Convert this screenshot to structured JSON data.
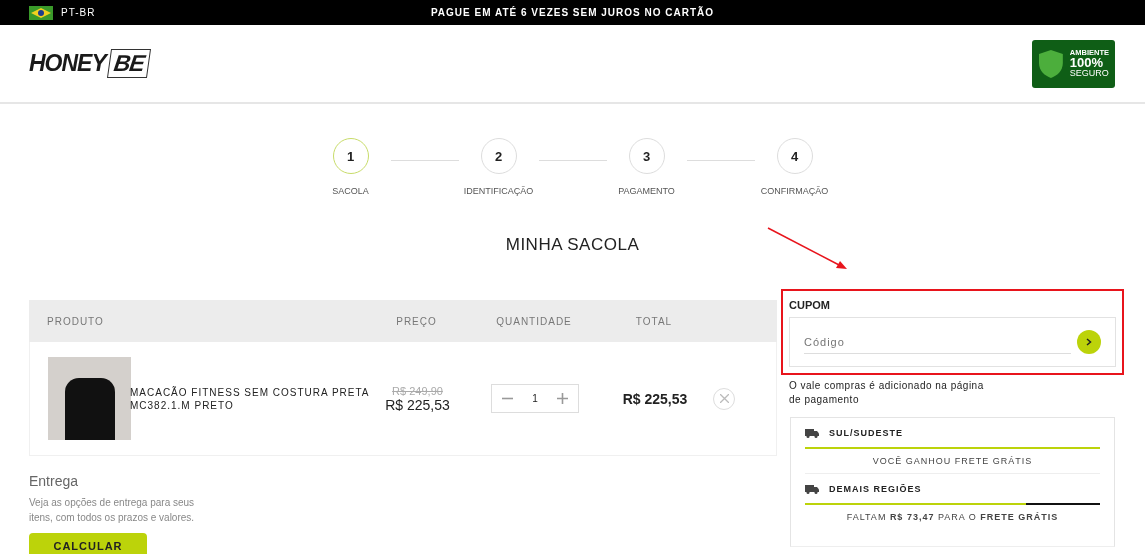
{
  "top_bar": {
    "language": "PT-BR",
    "promo": "PAGUE EM ATÉ 6 VEZES SEM JUROS NO CARTÃO"
  },
  "header": {
    "logo": [
      "HONEY",
      "BE"
    ],
    "security_badge": [
      "AMBIENTE",
      "100%",
      "SEGURO"
    ]
  },
  "steps": [
    {
      "number": "1",
      "label": "SACOLA",
      "selected": true
    },
    {
      "number": "2",
      "label": "IDENTIFICAÇÃO",
      "selected": false
    },
    {
      "number": "3",
      "label": "PAGAMENTO",
      "selected": false
    },
    {
      "number": "4",
      "label": "CONFIRMAÇÃO",
      "selected": false
    }
  ],
  "title": "MINHA SACOLA",
  "cart": {
    "columns": [
      "PRODUTO",
      "PREÇO",
      "QUANTIDADE",
      "TOTAL"
    ],
    "rows": [
      {
        "name": "MACACÃO FITNESS SEM COSTURA PRETA MC382.1.M PRETO",
        "old_price": "R$ 249,90",
        "price": "R$ 225,53",
        "quantity": "1",
        "total": "R$ 225,53"
      }
    ]
  },
  "delivery": {
    "title": "Entrega",
    "text": "Veja as opções de entrega para seus itens, com todos os prazos e valores.",
    "button": "CALCULAR"
  },
  "coupon": {
    "title": "CUPOM",
    "placeholder": "Código",
    "highlighted": true,
    "note": "O vale compras é adicionado na página de pagamento"
  },
  "shipping": [
    {
      "region": "SUL/SUDESTE",
      "level": 1,
      "message": "VOCÊ GANHOU FRETE GRÁTIS"
    },
    {
      "region": "DEMAIS REGIÕES",
      "level": 0.75,
      "message": "FALTAM **R$ 73,47** PARA O **FRETE GRÁTIS**"
    }
  ]
}
